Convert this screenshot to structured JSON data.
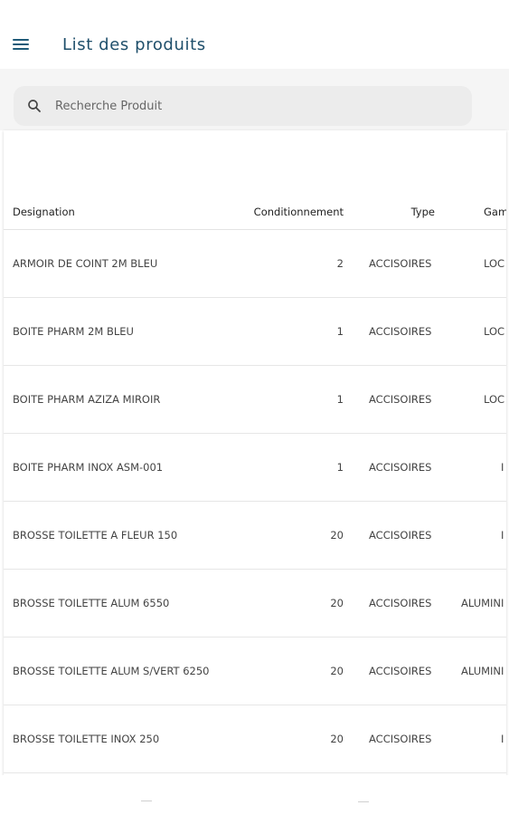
{
  "header": {
    "menu_icon": "hamburger-menu-icon",
    "title": "List des produits"
  },
  "search": {
    "icon": "search-icon",
    "placeholder": "Recherche Produit",
    "value": ""
  },
  "table": {
    "columns": [
      "Designation",
      "Conditionnement",
      "Type",
      "Gam"
    ],
    "rows": [
      {
        "designation": "ARMOIR DE COINT 2M BLEU",
        "conditionnement": "2",
        "type": "ACCISOIRES",
        "gamme": "LOC"
      },
      {
        "designation": "BOITE PHARM 2M BLEU",
        "conditionnement": "1",
        "type": "ACCISOIRES",
        "gamme": "LOC"
      },
      {
        "designation": "BOITE PHARM AZIZA MIROIR",
        "conditionnement": "1",
        "type": "ACCISOIRES",
        "gamme": "LOC"
      },
      {
        "designation": "BOITE PHARM INOX ASM-001",
        "conditionnement": "1",
        "type": "ACCISOIRES",
        "gamme": "I"
      },
      {
        "designation": "BROSSE TOILETTE A FLEUR 150",
        "conditionnement": "20",
        "type": "ACCISOIRES",
        "gamme": "I"
      },
      {
        "designation": "BROSSE TOILETTE ALUM  6550",
        "conditionnement": "20",
        "type": "ACCISOIRES",
        "gamme": "ALUMINI"
      },
      {
        "designation": "BROSSE TOILETTE ALUM  S/VERT  6250",
        "conditionnement": "20",
        "type": "ACCISOIRES",
        "gamme": "ALUMINI"
      },
      {
        "designation": "BROSSE TOILETTE INOX  250",
        "conditionnement": "20",
        "type": "ACCISOIRES",
        "gamme": "I"
      }
    ]
  },
  "colors": {
    "title": "#1f4f6b",
    "accent": "#1f5a78",
    "search_bg": "#ececec"
  }
}
